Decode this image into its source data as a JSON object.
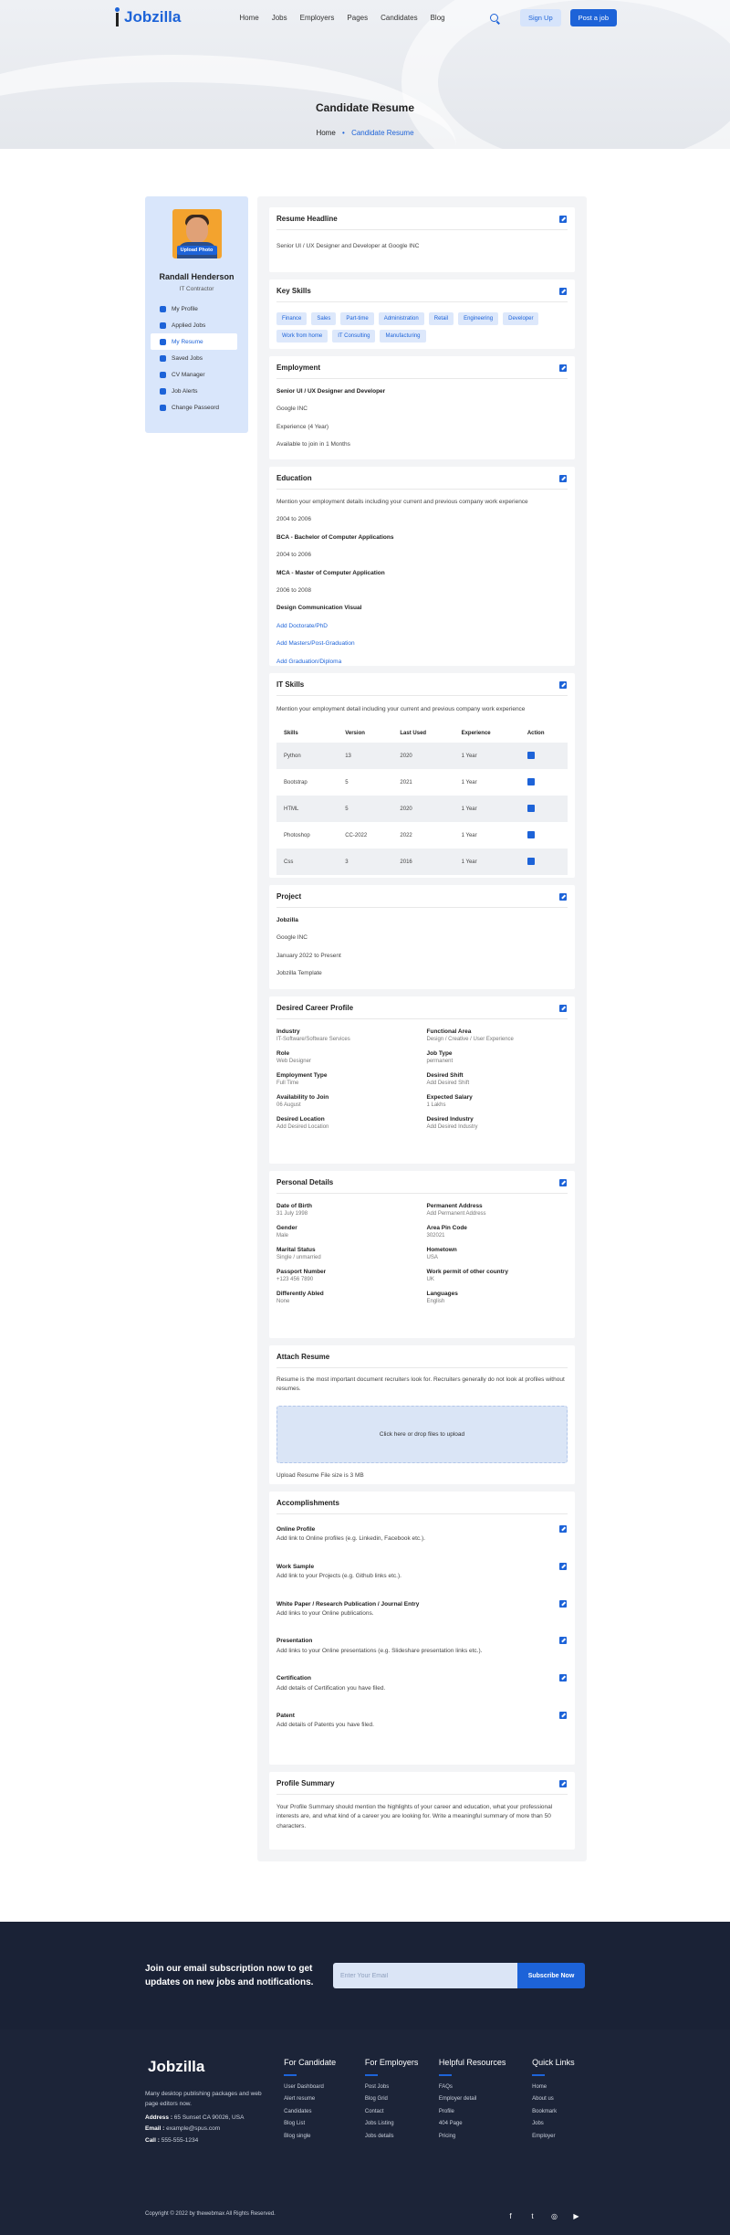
{
  "nav": {
    "brand": "Jobzilla",
    "links": [
      "Home",
      "Jobs",
      "Employers",
      "Pages",
      "Candidates",
      "Blog"
    ],
    "signup": "Sign Up",
    "post_job": "Post a job"
  },
  "hero": {
    "title": "Candidate Resume",
    "crumb_home": "Home",
    "crumb_sep": "•",
    "crumb_current": "Candidate Resume"
  },
  "sidebar": {
    "upload": "Upload Photo",
    "name": "Randall Henderson",
    "role": "IT Contractor",
    "items": [
      "My Profile",
      "Applied Jobs",
      "My Resume",
      "Saved Jobs",
      "CV Manager",
      "Job Alerts",
      "Change Passeord"
    ]
  },
  "headline": {
    "title": "Resume Headline",
    "text": "Senior UI / UX Designer and Developer at Google INC"
  },
  "key_skills": {
    "title": "Key Skills",
    "chips": [
      "Finance",
      "Sales",
      "Part-time",
      "Administration",
      "Retail",
      "Engineering",
      "Developer",
      "Work from home",
      "IT Consulting",
      "Manufacturing"
    ]
  },
  "employment": {
    "title": "Employment",
    "role": "Senior UI / UX Designer and Developer",
    "company": "Google INC",
    "experience": "Experience (4 Year)",
    "available": "Available to join in 1 Months"
  },
  "education": {
    "title": "Education",
    "intro": "Mention your employment details including your current and previous company work experience",
    "years1": "2004 to 2006",
    "deg1": "BCA - Bachelor of Computer Applications",
    "years2": "2004 to 2006",
    "deg2": "MCA - Master of Computer Application",
    "years3": "2006 to 2008",
    "deg3": "Design Communication Visual",
    "add1": "Add Doctorate/PhD",
    "add2": "Add Masters/Post-Graduation",
    "add3": "Add Graduation/Diploma"
  },
  "it_skills": {
    "title": "IT Skills",
    "intro": "Mention your employment detail including your current and previous company work experience",
    "headers": [
      "Skills",
      "Version",
      "Last Used",
      "Experience",
      "Action"
    ],
    "rows": [
      [
        "Python",
        "13",
        "2020",
        "1 Year"
      ],
      [
        "Bootstrap",
        "5",
        "2021",
        "1 Year"
      ],
      [
        "HTML",
        "5",
        "2020",
        "1 Year"
      ],
      [
        "Photoshop",
        "CC-2022",
        "2022",
        "1 Year"
      ],
      [
        "Css",
        "3",
        "2016",
        "1 Year"
      ]
    ]
  },
  "project": {
    "title": "Project",
    "name": "Jobzilla",
    "company": "Google INC",
    "period": "January 2022 to Present",
    "template": "Jobzilla Template"
  },
  "career": {
    "title": "Desired Career Profile",
    "fields": [
      [
        "Industry",
        "IT-Software/Software Services"
      ],
      [
        "Functional Area",
        "Design / Creative / User Experience"
      ],
      [
        "Role",
        "Web Designer"
      ],
      [
        "Job Type",
        "permanent"
      ],
      [
        "Employment Type",
        "Full Time"
      ],
      [
        "Desired Shift",
        "Add Desired Shift"
      ],
      [
        "Availability to Join",
        "06 August"
      ],
      [
        "Expected Salary",
        "1 Lakhs"
      ],
      [
        "Desired Location",
        "Add Desired Location"
      ],
      [
        "Desired Industry",
        "Add Desired Industry"
      ]
    ]
  },
  "personal": {
    "title": "Personal Details",
    "fields": [
      [
        "Date of Birth",
        "31 July 1998"
      ],
      [
        "Permanent Address",
        "Add Permanent Address"
      ],
      [
        "Gender",
        "Male"
      ],
      [
        "Area Pin Code",
        "302021"
      ],
      [
        "Marital Status",
        "Single / unmarried"
      ],
      [
        "Hometown",
        "USA"
      ],
      [
        "Passport Number",
        "+123 456 7890"
      ],
      [
        "Work permit of other country",
        "UK"
      ],
      [
        "Differently Abled",
        "None"
      ],
      [
        "Languages",
        "English"
      ]
    ]
  },
  "attach": {
    "title": "Attach Resume",
    "intro": "Resume is the most important document recruiters look for. Recruiters generally do not look at profiles without resumes.",
    "drop": "Click here or drop files to upload",
    "note": "Upload Resume File size is 3 MB"
  },
  "accomplishments": {
    "title": "Accomplishments",
    "items": [
      [
        "Online Profile",
        "Add link to Online profiles (e.g. Linkedin, Facebook etc.)."
      ],
      [
        "Work Sample",
        "Add link to your Projects (e.g. Github links etc.)."
      ],
      [
        "White Paper / Research Publication / Journal Entry",
        "Add links to your Online publications."
      ],
      [
        "Presentation",
        "Add links to your Online presentations (e.g. Slideshare presentation links etc.)."
      ],
      [
        "Certification",
        "Add details of Certification you have filed."
      ],
      [
        "Patent",
        "Add details of Patents you have filed."
      ]
    ]
  },
  "summary": {
    "title": "Profile Summary",
    "text": "Your Profile Summary should mention the highlights of your career and education, what your professional interests are, and what kind of a career you are looking for. Write a meaningful summary of more than 50 characters."
  },
  "subscribe": {
    "text": "Join our email subscription now to get updates on new jobs and notifications.",
    "placeholder": "Enter Your Email",
    "button": "Subscribe Now"
  },
  "footer": {
    "brand": "Jobzilla",
    "desc": "Many desktop publishing packages and web page editors now.",
    "address_label": "Address :",
    "address": "65 Sunset CA 90026, USA",
    "email_label": "Email :",
    "email": "example@spus.com",
    "call_label": "Call :",
    "call": "555-555-1234",
    "columns": [
      {
        "title": "For Candidate",
        "links": [
          "User Dashboard",
          "Alert resume",
          "Candidates",
          "Blog List",
          "Blog single"
        ]
      },
      {
        "title": "For Employers",
        "links": [
          "Post Jobs",
          "Blog Grid",
          "Contact",
          "Jobs Listing",
          "Jobs details"
        ]
      },
      {
        "title": "Helpful Resources",
        "links": [
          "FAQs",
          "Employer detail",
          "Profile",
          "404 Page",
          "Pricing"
        ]
      },
      {
        "title": "Quick Links",
        "links": [
          "Home",
          "About us",
          "Bookmark",
          "Jobs",
          "Employer"
        ]
      }
    ],
    "copyright": "Copyright © 2022 by thewebmax All Rights Reserved.",
    "socials": [
      "f",
      "t",
      "◎",
      "▶"
    ]
  }
}
